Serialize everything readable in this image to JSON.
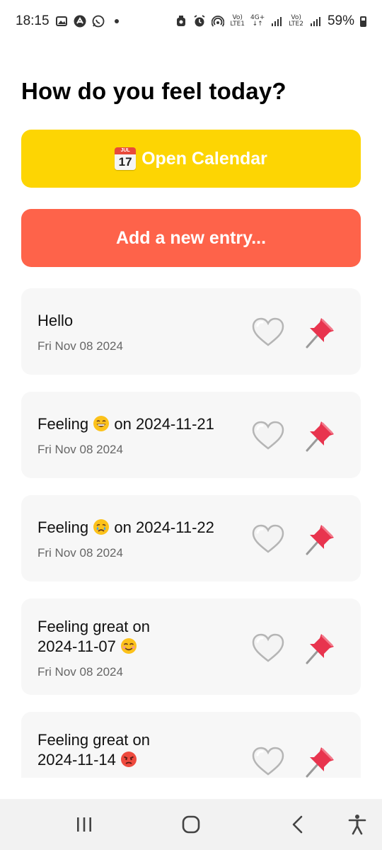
{
  "status_bar": {
    "time": "18:15",
    "volte1": "Vo)",
    "lte1": "LTE1",
    "net_type": "4G+",
    "volte2": "Vo)",
    "lte2": "LTE2",
    "battery": "59%"
  },
  "page": {
    "title": "How do you feel today?"
  },
  "buttons": {
    "calendar_label": "Open Calendar",
    "calendar_emoji_month": "JUL",
    "calendar_emoji_day": "17",
    "add_label": "Add a new entry..."
  },
  "entries": [
    {
      "title": "Hello",
      "date": "Fri Nov 08 2024"
    },
    {
      "title_prefix": "Feeling",
      "emoji": "grinning-face",
      "title_suffix": "on 2024-11-21",
      "date": "Fri Nov 08 2024"
    },
    {
      "title_prefix": "Feeling",
      "emoji": "crying-face",
      "title_suffix": "on 2024-11-22",
      "date": "Fri Nov 08 2024"
    },
    {
      "title_line1": "Feeling great on",
      "title_line2": "2024-11-07",
      "emoji": "smiling-face",
      "date": "Fri Nov 08 2024"
    },
    {
      "title_line1": "Feeling great on",
      "title_line2": "2024-11-14",
      "emoji": "angry-face"
    }
  ],
  "icons": {
    "favorite": "white-heart-icon",
    "pin": "pushpin-icon"
  },
  "colors": {
    "calendar_button": "#fdd503",
    "add_button": "#fe634a",
    "card_background": "#f7f7f7",
    "pin_red": "#e8344e"
  }
}
